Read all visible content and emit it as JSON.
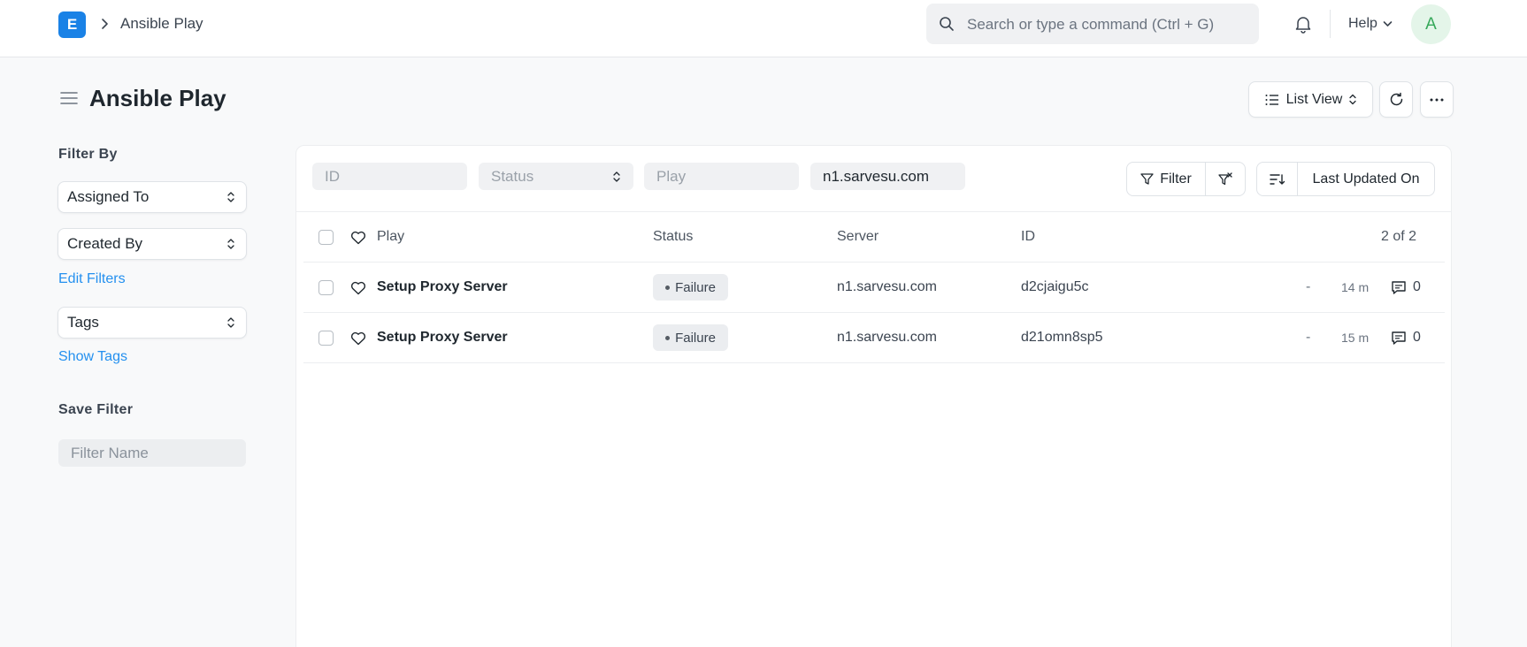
{
  "navbar": {
    "logo_letter": "E",
    "breadcrumb": "Ansible Play",
    "search_placeholder": "Search or type a command (Ctrl + G)",
    "help_label": "Help",
    "avatar_initial": "A"
  },
  "page": {
    "title": "Ansible Play",
    "list_view_label": "List View"
  },
  "sidebar": {
    "filter_by_heading": "Filter By",
    "assigned_to": "Assigned To",
    "created_by": "Created By",
    "edit_filters": "Edit Filters",
    "tags": "Tags",
    "show_tags": "Show Tags",
    "save_filter_heading": "Save Filter",
    "filter_name_placeholder": "Filter Name"
  },
  "filters": {
    "id_placeholder": "ID",
    "status_placeholder": "Status",
    "play_placeholder": "Play",
    "server_value": "n1.sarvesu.com",
    "filter_label": "Filter",
    "sort_label": "Last Updated On"
  },
  "list": {
    "columns": {
      "play": "Play",
      "status": "Status",
      "server": "Server",
      "id": "ID"
    },
    "count": "2 of 2",
    "rows": [
      {
        "play": "Setup Proxy Server",
        "status": "Failure",
        "server": "n1.sarvesu.com",
        "id": "d2cjaigu5c",
        "dash": "-",
        "ago": "14 m",
        "comments": "0"
      },
      {
        "play": "Setup Proxy Server",
        "status": "Failure",
        "server": "n1.sarvesu.com",
        "id": "d21omn8sp5",
        "dash": "-",
        "ago": "15 m",
        "comments": "0"
      }
    ]
  },
  "colors": {
    "brand": "#1a82e6",
    "link": "#2490ef",
    "avatar_bg": "#e4f5e9",
    "avatar_fg": "#36a85a",
    "badge_bg": "#ebedf0"
  },
  "icons": [
    "chevron-right-icon",
    "search-icon",
    "bell-icon",
    "chevron-down-icon",
    "menu-icon",
    "list-icon",
    "sort-updown-icon",
    "refresh-icon",
    "more-icon",
    "filter-icon",
    "filter-clear-icon",
    "sort-direction-icon",
    "heart-icon",
    "comment-icon"
  ]
}
